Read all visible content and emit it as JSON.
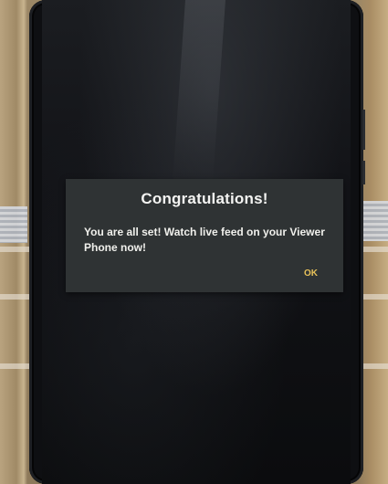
{
  "dialog": {
    "title": "Congratulations!",
    "message": "You are all set! Watch live feed on your Viewer Phone now!",
    "ok_label": "OK"
  },
  "colors": {
    "dialog_background": "#2f3334",
    "title_text": "#f4f4f2",
    "accent_ok": "#e8c25a",
    "screen_background": "#121317"
  }
}
